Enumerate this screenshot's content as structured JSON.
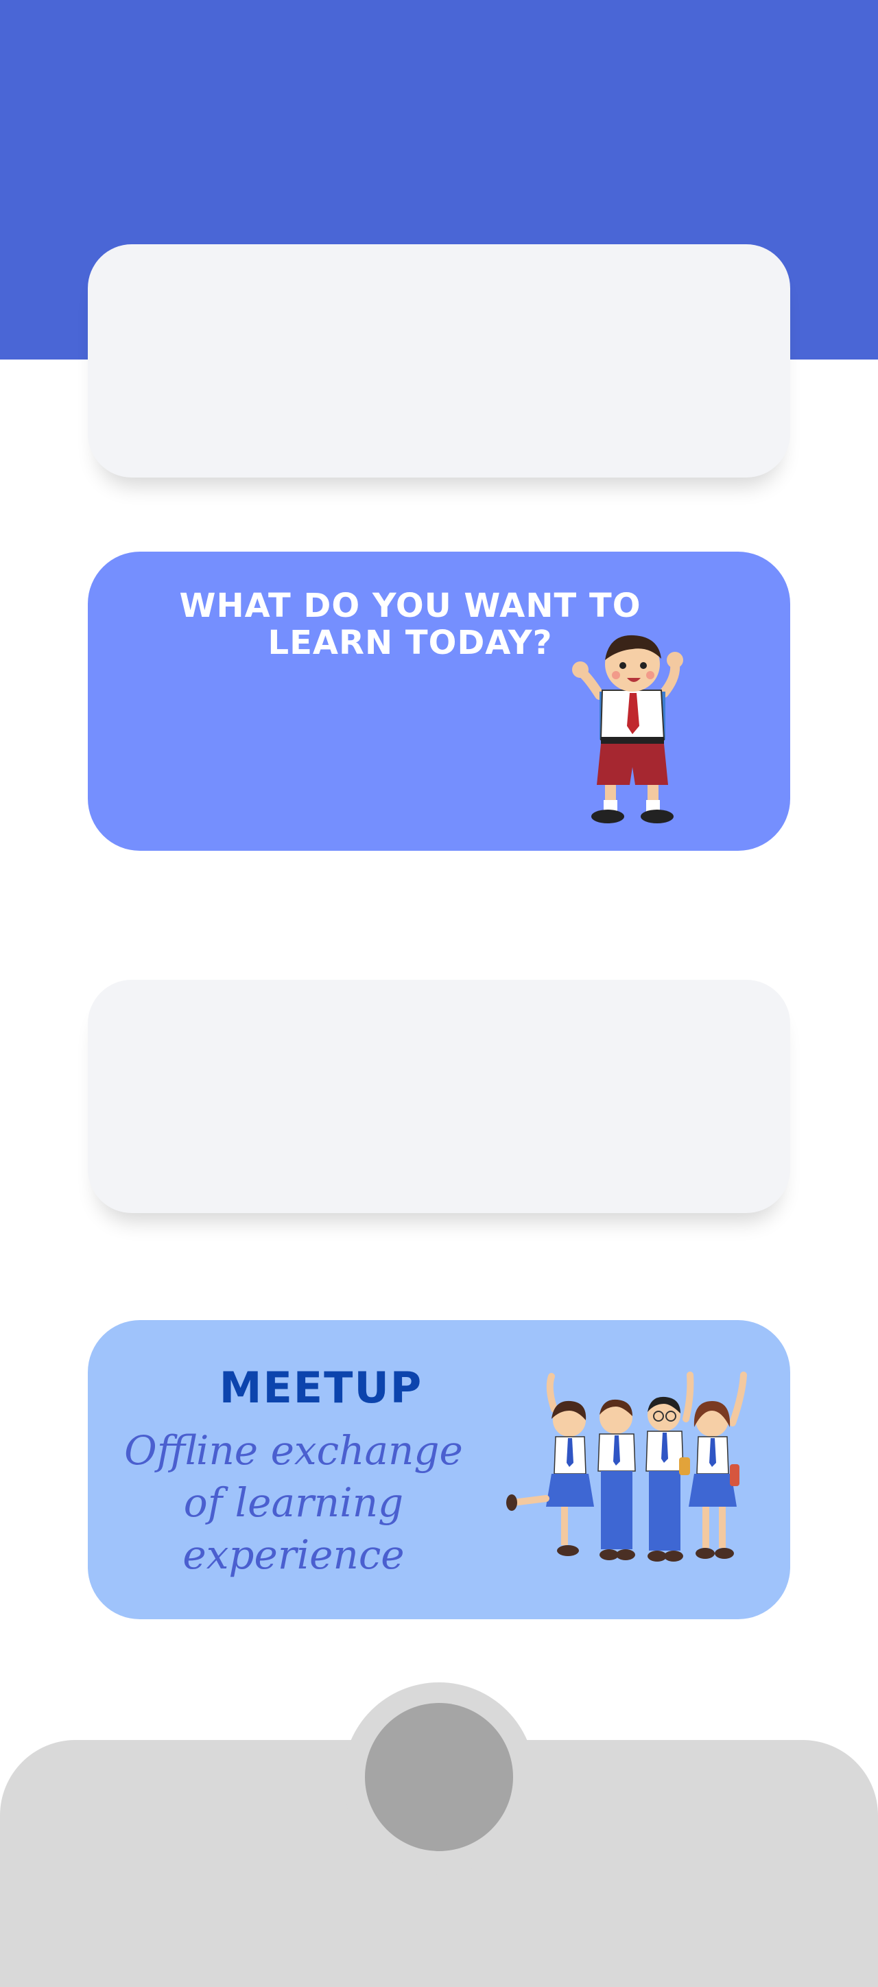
{
  "learn_card": {
    "title": "WHAT DO YOU WANT TO LEARN TODAY?",
    "illustration": "waving-schoolboy-icon"
  },
  "meetup_card": {
    "title": "MEETUP",
    "subtitle": "Offline exchange of learning experience",
    "illustration": "group-of-students-icon"
  },
  "colors": {
    "header": "#4a66d6",
    "learn_card": "#758ffe",
    "meetup_card": "#9fc3fb",
    "meetup_title": "#0c44ad",
    "meetup_subtitle": "#4a5fcf",
    "placeholder_card": "#f3f4f7",
    "bottom_bar": "#d9d9d9",
    "fab": "#a5a5a5"
  }
}
